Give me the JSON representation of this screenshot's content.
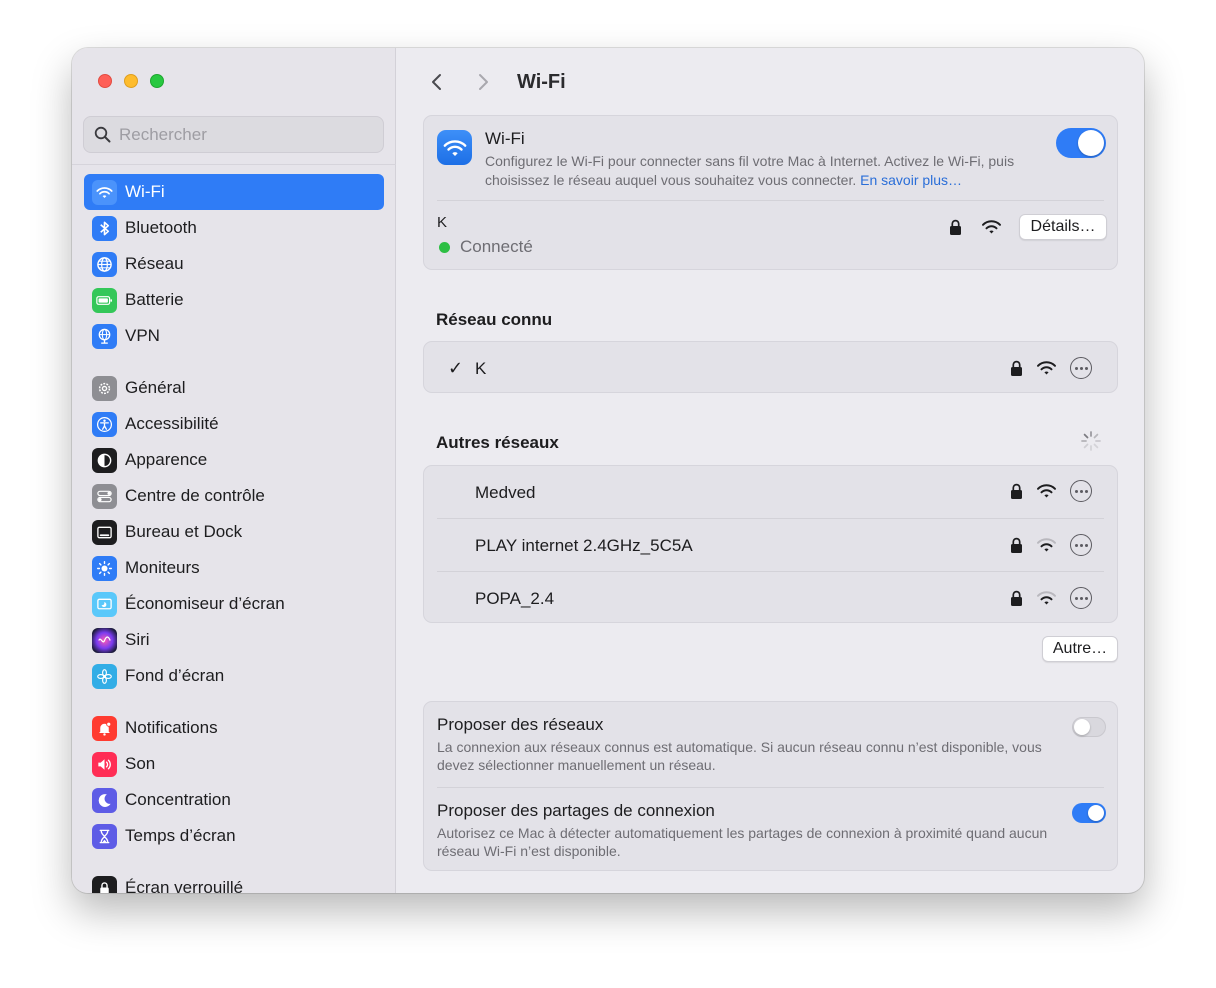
{
  "window": {
    "title": "Wi-Fi"
  },
  "search": {
    "placeholder": "Rechercher"
  },
  "sidebar": {
    "items": [
      {
        "label": "Wi-Fi",
        "icon": "wifi-icon",
        "color": "#2f7cf6",
        "active": true
      },
      {
        "label": "Bluetooth",
        "icon": "bluetooth-icon",
        "color": "#2f7cf6"
      },
      {
        "label": "Réseau",
        "icon": "globe-icon",
        "color": "#2f7cf6"
      },
      {
        "label": "Batterie",
        "icon": "battery-icon",
        "color": "#34c759"
      },
      {
        "label": "VPN",
        "icon": "vpn-globe-icon",
        "color": "#2f7cf6"
      },
      {
        "label": "Général",
        "icon": "gear-icon",
        "color": "#8e8e93"
      },
      {
        "label": "Accessibilité",
        "icon": "accessibility-icon",
        "color": "#2f7cf6"
      },
      {
        "label": "Apparence",
        "icon": "appearance-icon",
        "color": "#1d1d1f"
      },
      {
        "label": "Centre de contrôle",
        "icon": "control-center-icon",
        "color": "#8e8e93"
      },
      {
        "label": "Bureau et Dock",
        "icon": "dock-icon",
        "color": "#1d1d1f"
      },
      {
        "label": "Moniteurs",
        "icon": "sun-icon",
        "color": "#2f7cf6"
      },
      {
        "label": "Économiseur d’écran",
        "icon": "screensaver-icon",
        "color": "#5ac8fa"
      },
      {
        "label": "Siri",
        "icon": "siri-icon",
        "color": "#7a3cf0"
      },
      {
        "label": "Fond d’écran",
        "icon": "flower-icon",
        "color": "#32ade6"
      },
      {
        "label": "Notifications",
        "icon": "bell-icon",
        "color": "#ff3b30"
      },
      {
        "label": "Son",
        "icon": "speaker-icon",
        "color": "#ff2d55"
      },
      {
        "label": "Concentration",
        "icon": "moon-icon",
        "color": "#5e5ce6"
      },
      {
        "label": "Temps d’écran",
        "icon": "hourglass-icon",
        "color": "#5e5ce6"
      },
      {
        "label": "Écran verrouillé",
        "icon": "lock-icon",
        "color": "#1d1d1f"
      }
    ]
  },
  "wifi": {
    "title": "Wi-Fi",
    "description": "Configurez le Wi-Fi pour connecter sans fil votre Mac à Internet. Activez le Wi-Fi, puis choisissez le réseau auquel vous souhaitez vous connecter.",
    "learn_more": "En savoir plus…",
    "enabled": true,
    "current_network": "K",
    "status": "Connecté",
    "details_button": "Détails…"
  },
  "known": {
    "title": "Réseau connu",
    "networks": [
      {
        "name": "K",
        "check": "✓"
      }
    ]
  },
  "others": {
    "title": "Autres réseaux",
    "networks": [
      {
        "name": "Medved"
      },
      {
        "name": "PLAY internet 2.4GHz_5C5A"
      },
      {
        "name": "POPA_2.4"
      }
    ],
    "other_button": "Autre…"
  },
  "prefs": {
    "ask_networks": {
      "title": "Proposer des réseaux",
      "description": "La connexion aux réseaux connus est automatique. Si aucun réseau connu n’est disponible, vous devez sélectionner manuellement un réseau.",
      "enabled": false
    },
    "ask_hotspots": {
      "title": "Proposer des partages de connexion",
      "description": "Autorisez ce Mac à détecter automatiquement les partages de connexion à proximité quand aucun réseau Wi-Fi n’est disponible.",
      "enabled": true
    }
  }
}
